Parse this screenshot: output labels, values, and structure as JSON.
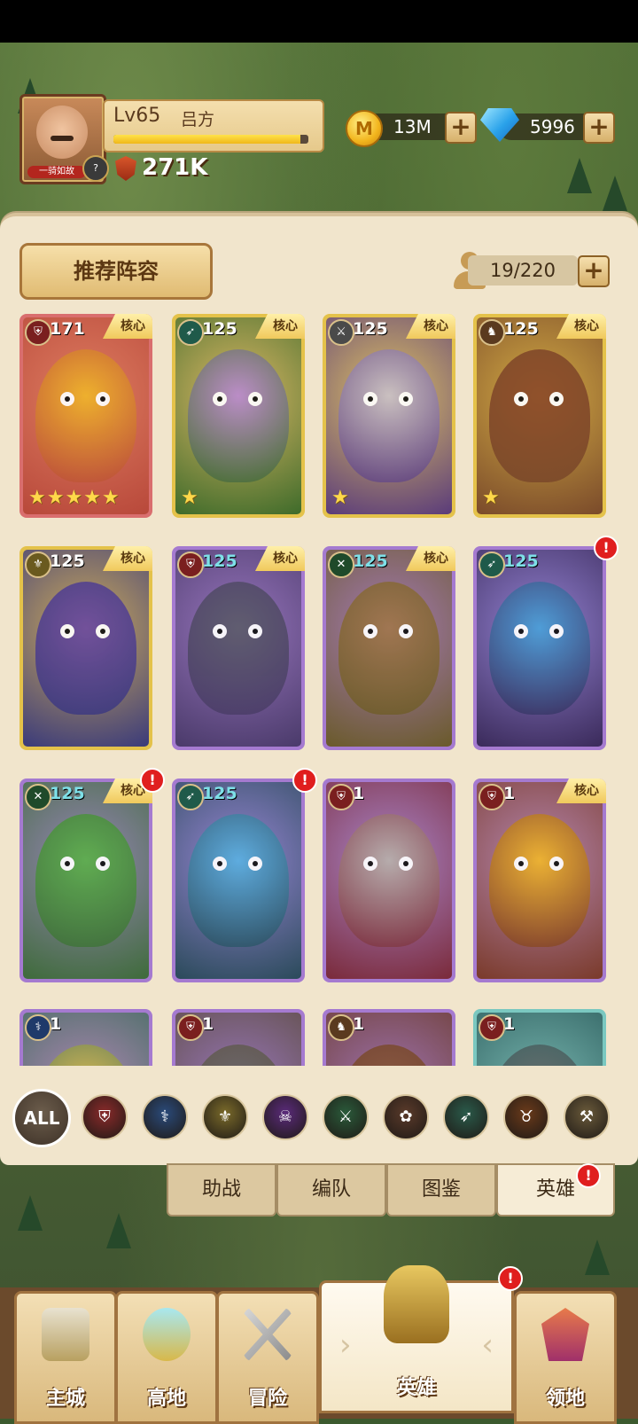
{
  "player": {
    "level": "Lv65",
    "name": "吕方",
    "power": "271K",
    "avatar_title": "一骑如故",
    "avatar_emblem": "?",
    "xp_fraction": 0.96
  },
  "currency": {
    "coin_symbol": "M",
    "coins": "13M",
    "gems": "5996",
    "add_symbol": "+"
  },
  "toolbar": {
    "recommend_label": "推荐阵容",
    "hero_count": "19/220"
  },
  "core_label": "核心",
  "alert_symbol": "!",
  "heroes": [
    {
      "level": "171",
      "role": "tank",
      "core": true,
      "stars": "★★★★★",
      "frame": "#d96e6e",
      "bg": "#b8483a",
      "char": "#f0b52a",
      "alert": false,
      "lvcolor": "#ffffff"
    },
    {
      "level": "125",
      "role": "archer",
      "core": true,
      "stars": "★",
      "frame": "#e4c24a",
      "bg": "#3e6b2a",
      "char": "#b98ad0",
      "alert": false,
      "lvcolor": "#ffffff"
    },
    {
      "level": "125",
      "role": "warrior",
      "core": true,
      "stars": "★",
      "frame": "#e4c24a",
      "bg": "#5a3b7a",
      "char": "#c9c0c8",
      "alert": false,
      "lvcolor": "#ffffff"
    },
    {
      "level": "125",
      "role": "beast",
      "core": true,
      "stars": "★",
      "frame": "#e4c24a",
      "bg": "#7a4a2a",
      "char": "#8b4a2a",
      "alert": false,
      "lvcolor": "#ffffff"
    },
    {
      "level": "125",
      "role": "mage",
      "core": true,
      "stars": "",
      "frame": "#e4c24a",
      "bg": "#3a3a7a",
      "char": "#6b4aa0",
      "alert": false,
      "lvcolor": "#ffffff"
    },
    {
      "level": "125",
      "role": "tank",
      "core": true,
      "stars": "",
      "frame": "#a57ad0",
      "bg": "#4a3a6a",
      "char": "#5c5c6a",
      "alert": false,
      "lvcolor": "#7ee0e8"
    },
    {
      "level": "125",
      "role": "assassin",
      "core": true,
      "stars": "",
      "frame": "#a57ad0",
      "bg": "#6a5a2a",
      "char": "#a0764a",
      "alert": false,
      "lvcolor": "#7ee0e8"
    },
    {
      "level": "125",
      "role": "archer",
      "core": false,
      "stars": "",
      "frame": "#a57ad0",
      "bg": "#3a2a5a",
      "char": "#4aa0d8",
      "alert": true,
      "lvcolor": "#7ee0e8"
    },
    {
      "level": "125",
      "role": "assassin",
      "core": true,
      "stars": "",
      "frame": "#a57ad0",
      "bg": "#3e6b3a",
      "char": "#5cb04a",
      "alert": true,
      "lvcolor": "#7ee0e8"
    },
    {
      "level": "125",
      "role": "archer",
      "core": false,
      "stars": "",
      "frame": "#a57ad0",
      "bg": "#2a4a5a",
      "char": "#5ab0e0",
      "alert": true,
      "lvcolor": "#7ee0e8"
    },
    {
      "level": "1",
      "role": "tank",
      "core": false,
      "stars": "",
      "frame": "#a57ad0",
      "bg": "#7a2a3a",
      "char": "#b8b0aa",
      "alert": false,
      "lvcolor": "#ffffff"
    },
    {
      "level": "1",
      "role": "tank",
      "core": true,
      "stars": "",
      "frame": "#a57ad0",
      "bg": "#7a3a2a",
      "char": "#f0b52a",
      "alert": false,
      "lvcolor": "#ffffff"
    },
    {
      "level": "1",
      "role": "support",
      "core": false,
      "stars": "",
      "frame": "#a57ad0",
      "bg": "#3a6a5a",
      "char": "#e0c04a",
      "alert": false,
      "lvcolor": "#ffffff"
    },
    {
      "level": "1",
      "role": "tank",
      "core": false,
      "stars": "",
      "frame": "#a57ad0",
      "bg": "#5a4a3a",
      "char": "#6a6a6a",
      "alert": false,
      "lvcolor": "#ffffff"
    },
    {
      "level": "1",
      "role": "beast",
      "core": false,
      "stars": "",
      "frame": "#a57ad0",
      "bg": "#6a3a2a",
      "char": "#8a5a3a",
      "alert": false,
      "lvcolor": "#ffffff"
    },
    {
      "level": "1",
      "role": "tank",
      "core": false,
      "stars": "",
      "frame": "#7ac8c0",
      "bg": "#2a5a5a",
      "char": "#6a6a6a",
      "alert": false,
      "lvcolor": "#ffffff"
    }
  ],
  "filters": {
    "all_label": "ALL",
    "classes": [
      {
        "icon": "shield-icon",
        "glyph": "⛨",
        "color": "#8a2a2a"
      },
      {
        "icon": "staff-icon",
        "glyph": "⚕",
        "color": "#2a4a7a"
      },
      {
        "icon": "wings-icon",
        "glyph": "⚜",
        "color": "#7a6a2a"
      },
      {
        "icon": "skull-icon",
        "glyph": "☠",
        "color": "#5a2a7a"
      },
      {
        "icon": "daggers-icon",
        "glyph": "⚔",
        "color": "#2a5a3a"
      },
      {
        "icon": "paw-icon",
        "glyph": "✿",
        "color": "#5a3a2a"
      },
      {
        "icon": "bow-icon",
        "glyph": "➶",
        "color": "#2a5a4a"
      },
      {
        "icon": "bull-icon",
        "glyph": "♉",
        "color": "#6a3a1a"
      },
      {
        "icon": "axe-icon",
        "glyph": "⚒",
        "color": "#6a5a3a"
      }
    ]
  },
  "tabs": [
    "助战",
    "编队",
    "图鉴",
    "英雄"
  ],
  "nav": {
    "items": [
      "主城",
      "高地",
      "冒险",
      "英雄",
      "领地"
    ],
    "left_arrow": "›",
    "right_arrow": "‹"
  }
}
